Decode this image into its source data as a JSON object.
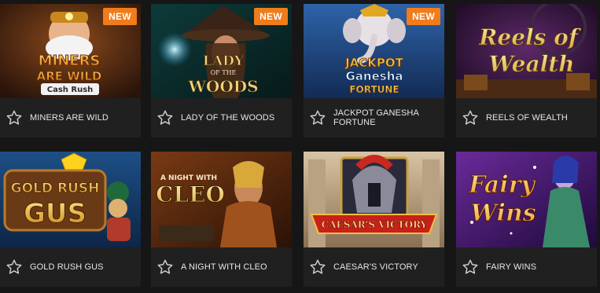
{
  "games": [
    {
      "title": "MINERS ARE WILD",
      "art_lines": [
        "MINERS",
        "ARE WILD",
        "Cash Rush"
      ],
      "badge": "NEW"
    },
    {
      "title": "LADY OF THE WOODS",
      "art_lines": [
        "LADY",
        "OF THE",
        "WOODS"
      ],
      "badge": "NEW"
    },
    {
      "title": "JACKPOT GANESHA FORTUNE",
      "art_lines": [
        "JACKPOT",
        "Ganesha",
        "FORTUNE"
      ],
      "badge": "NEW"
    },
    {
      "title": "REELS OF WEALTH",
      "art_lines": [
        "Reels of",
        "Wealth"
      ],
      "badge": ""
    },
    {
      "title": "GOLD RUSH GUS",
      "art_lines": [
        "GOLD RUSH",
        "GUS"
      ],
      "badge": ""
    },
    {
      "title": "A NIGHT WITH CLEO",
      "art_lines": [
        "A NIGHT WITH",
        "CLEO"
      ],
      "badge": ""
    },
    {
      "title": "CAESAR'S VICTORY",
      "art_lines": [
        "CAESAR'S VICTORY"
      ],
      "badge": ""
    },
    {
      "title": "FAIRY WINS",
      "art_lines": [
        "Fairy",
        "Wins"
      ],
      "badge": ""
    }
  ],
  "icons": {
    "favorite": "star-outline-icon"
  },
  "colors": {
    "badge": "#f07c1b",
    "card": "#202020",
    "background": "#161616",
    "label": "#e6e6e6"
  }
}
